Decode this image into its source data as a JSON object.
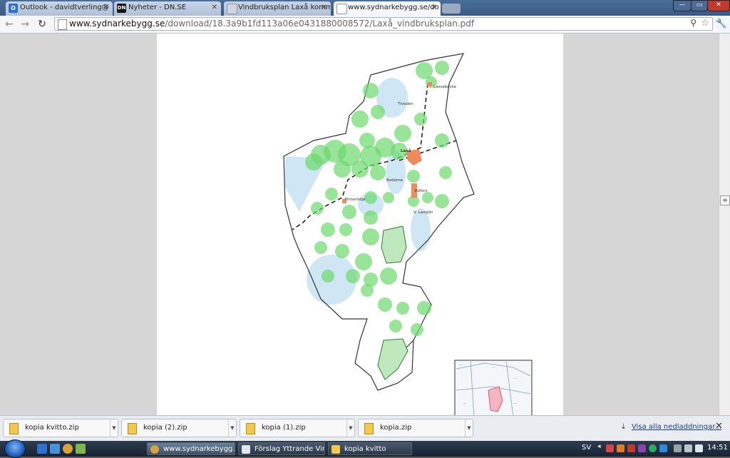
{
  "browser": {
    "tabs": [
      {
        "label": "Outlook - davidtverling@",
        "icon": "outlook-icon",
        "color": "#2f6fd1"
      },
      {
        "label": "Nyheter - DN.SE",
        "icon": "dn-logo-icon",
        "color": "#111111"
      },
      {
        "label": "Vindbruksplan Laxå komm",
        "icon": "page-icon",
        "color": "#7a8aa0"
      },
      {
        "label": "www.sydnarkebygg.se/do",
        "icon": "page-icon",
        "color": "#7a8aa0"
      }
    ],
    "address_host": "www.sydnarkebygg.se",
    "address_path": "/download/18.3a9b1fd113a06e0431880008572/Laxå_vindbruksplan.pdf"
  },
  "map": {
    "labels": [
      "Laxå",
      "Tiveden",
      "Röfors",
      "Finnerödja",
      "Lassabacka",
      "Bodarne",
      "V. Laxsjön"
    ],
    "colors": {
      "outline": "#333333",
      "area_green": "#6cd86c",
      "town": "#f08a5d",
      "water": "#cfe6f5"
    }
  },
  "downloads": {
    "items": [
      "kopia kvitto.zip",
      "kopia (2).zip",
      "kopia (1).zip",
      "kopia.zip"
    ],
    "show_all": "Visa alla nedladdningar..."
  },
  "taskbar": {
    "items": [
      "www.sydnarkebygg....",
      "Förslag Yttrande Vin...",
      "kopia kvitto"
    ],
    "lang": "SV",
    "time": "14:51"
  }
}
